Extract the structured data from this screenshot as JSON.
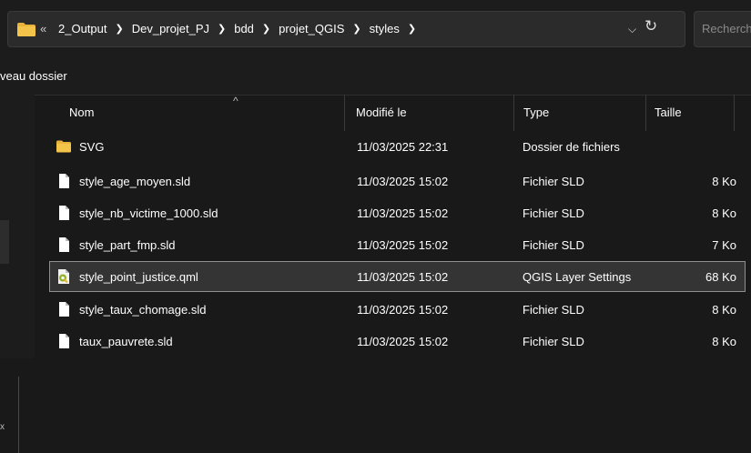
{
  "address_bar": {
    "overflow_label": "«",
    "breadcrumbs": [
      "2_Output",
      "Dev_projet_PJ",
      "bdd",
      "projet_QGIS",
      "styles"
    ],
    "search_placeholder": "Recherch"
  },
  "toolbar": {
    "new_folder_label": "veau dossier"
  },
  "columns": {
    "name": "Nom",
    "modified": "Modifié le",
    "type": "Type",
    "size": "Taille"
  },
  "files": [
    {
      "name": "SVG",
      "modified": "11/03/2025 22:31",
      "type": "Dossier de fichiers",
      "size": "",
      "icon": "folder-icon"
    },
    {
      "name": "style_age_moyen.sld",
      "modified": "11/03/2025 15:02",
      "type": "Fichier SLD",
      "size": "8 Ko",
      "icon": "file-icon"
    },
    {
      "name": "style_nb_victime_1000.sld",
      "modified": "11/03/2025 15:02",
      "type": "Fichier SLD",
      "size": "8 Ko",
      "icon": "file-icon"
    },
    {
      "name": "style_part_fmp.sld",
      "modified": "11/03/2025 15:02",
      "type": "Fichier SLD",
      "size": "7 Ko",
      "icon": "file-icon"
    },
    {
      "name": "style_point_justice.qml",
      "modified": "11/03/2025 15:02",
      "type": "QGIS Layer Settings",
      "size": "68 Ko",
      "icon": "qgis-file-icon",
      "selected": true
    },
    {
      "name": "style_taux_chomage.sld",
      "modified": "11/03/2025 15:02",
      "type": "Fichier SLD",
      "size": "8 Ko",
      "icon": "file-icon"
    },
    {
      "name": "taux_pauvrete.sld",
      "modified": "11/03/2025 15:02",
      "type": "Fichier SLD",
      "size": "8 Ko",
      "icon": "file-icon"
    }
  ],
  "colors": {
    "background": "#191919",
    "selected_row": "#343434",
    "folder": "#f4c44a"
  }
}
